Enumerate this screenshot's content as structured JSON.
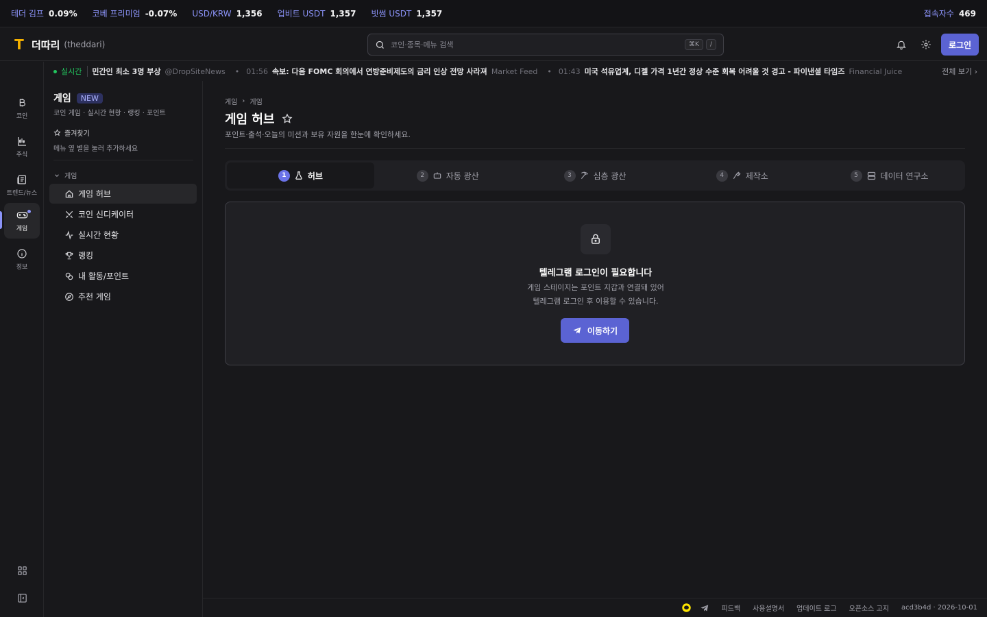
{
  "ticker": [
    {
      "label": "테더 김프",
      "value": "0.09%"
    },
    {
      "label": "코베 프리미엄",
      "value": "-0.07%"
    },
    {
      "label": "USD/KRW",
      "value": "1,356"
    },
    {
      "label": "업비트 USDT",
      "value": "1,357"
    },
    {
      "label": "빗썸 USDT",
      "value": "1,357"
    }
  ],
  "users": {
    "label": "접속자수",
    "value": "469"
  },
  "brand": {
    "mark": "T",
    "name": "더따리",
    "sub": "(theddari)"
  },
  "search": {
    "placeholder": "코인·종목·메뉴 검색",
    "kbd1": "⌘K",
    "kbd2": "/"
  },
  "header": {
    "login": "로그인"
  },
  "news": {
    "live": "실시간",
    "items": [
      {
        "time": "",
        "headline": "민간인 최소 3명 부상",
        "source": "@DropSiteNews"
      },
      {
        "time": "01:56",
        "headline": "속보: 다음 FOMC 회의에서 연방준비제도의 금리 인상 전망 사라져",
        "source": "Market Feed"
      },
      {
        "time": "01:43",
        "headline": "미국 석유업계, 디젤 가격 1년간 정상 수준 회복 어려울 것 경고 - 파이낸셜 타임즈",
        "source": "Financial Juice"
      }
    ],
    "view_all": "전체 보기 ›"
  },
  "rail": {
    "coin": "코인",
    "stock": "주식",
    "trend": "트렌드/뉴스",
    "game": "게임",
    "info": "정보"
  },
  "sidebar": {
    "title": "게임",
    "badge": "NEW",
    "desc": "코인 게임 · 실시간 현황 · 랭킹 · 포인트",
    "fav": "즐겨찾기",
    "fav_hint": "메뉴 옆 별을 눌러 추가하세요",
    "group": "게임",
    "items": [
      {
        "label": "게임 허브"
      },
      {
        "label": "코인 신디케이터"
      },
      {
        "label": "실시간 현황"
      },
      {
        "label": "랭킹"
      },
      {
        "label": "내 활동/포인트"
      },
      {
        "label": "추천 게임"
      }
    ]
  },
  "main": {
    "crumb1": "게임",
    "crumb_sep": "›",
    "crumb2": "게임",
    "title": "게임 허브",
    "desc": "포인트·출석·오늘의 미션과 보유 자원을 한눈에 확인하세요.",
    "tabs": [
      {
        "num": "1",
        "label": "허브"
      },
      {
        "num": "2",
        "label": "자동 광산"
      },
      {
        "num": "3",
        "label": "심층 광산"
      },
      {
        "num": "4",
        "label": "제작소"
      },
      {
        "num": "5",
        "label": "데이터 연구소"
      }
    ],
    "card": {
      "heading": "텔레그램 로그인이 필요합니다",
      "line1": "게임 스테이지는 포인트 지갑과 연결돼 있어",
      "line2": "텔레그램 로그인 후 이용할 수 있습니다.",
      "button": "이동하기"
    }
  },
  "footer": {
    "links": [
      "피드백",
      "사용설명서",
      "업데이트 로그",
      "오픈소스 고지"
    ],
    "version": "acd3b4d · 2026-10-01"
  },
  "colors": {
    "accent": "#5b63d3",
    "accent_light": "#8b93f8",
    "brand": "#f5b100",
    "live": "#22c55e"
  }
}
